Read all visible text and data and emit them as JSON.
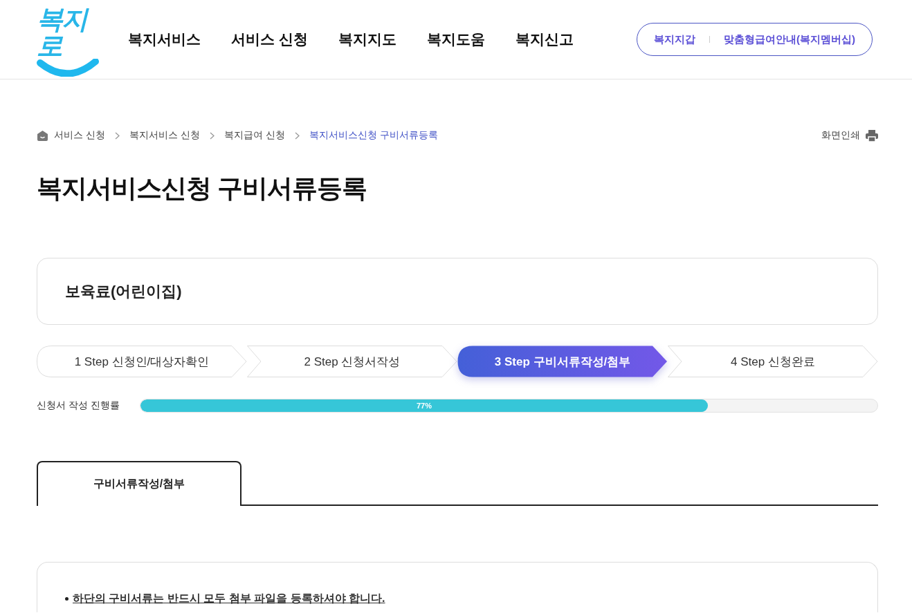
{
  "header": {
    "logo": "복지로",
    "nav": [
      "복지서비스",
      "서비스 신청",
      "복지지도",
      "복지도움",
      "복지신고"
    ],
    "quick_links": [
      "복지지갑",
      "맞춤형급여안내(복지멤버십)"
    ]
  },
  "breadcrumb": [
    {
      "label": "서비스 신청",
      "current": false
    },
    {
      "label": "복지서비스 신청",
      "current": false
    },
    {
      "label": "복지급여 신청",
      "current": false
    },
    {
      "label": "복지서비스신청 구비서류등록",
      "current": true
    }
  ],
  "print_label": "화면인쇄",
  "page_title": "복지서비스신청 구비서류등록",
  "service_name": "보육료(어린이집)",
  "steps": [
    {
      "label": "1 Step 신청인/대상자확인",
      "selected": false
    },
    {
      "label": "2 Step 신청서작성",
      "selected": false
    },
    {
      "label": "3 Step 구비서류작성/첨부",
      "selected": true
    },
    {
      "label": "4 Step 신청완료",
      "selected": false
    }
  ],
  "progress": {
    "label": "신청서 작성 진행률",
    "level": 0.77,
    "reading": "77%"
  },
  "tabs": [
    {
      "label": "구비서류작성/첨부",
      "selected": true
    }
  ],
  "notice": {
    "items": [
      "하단의 구비서류는 반드시 모두 첨부 파일을 등록하셔야 합니다."
    ]
  }
}
